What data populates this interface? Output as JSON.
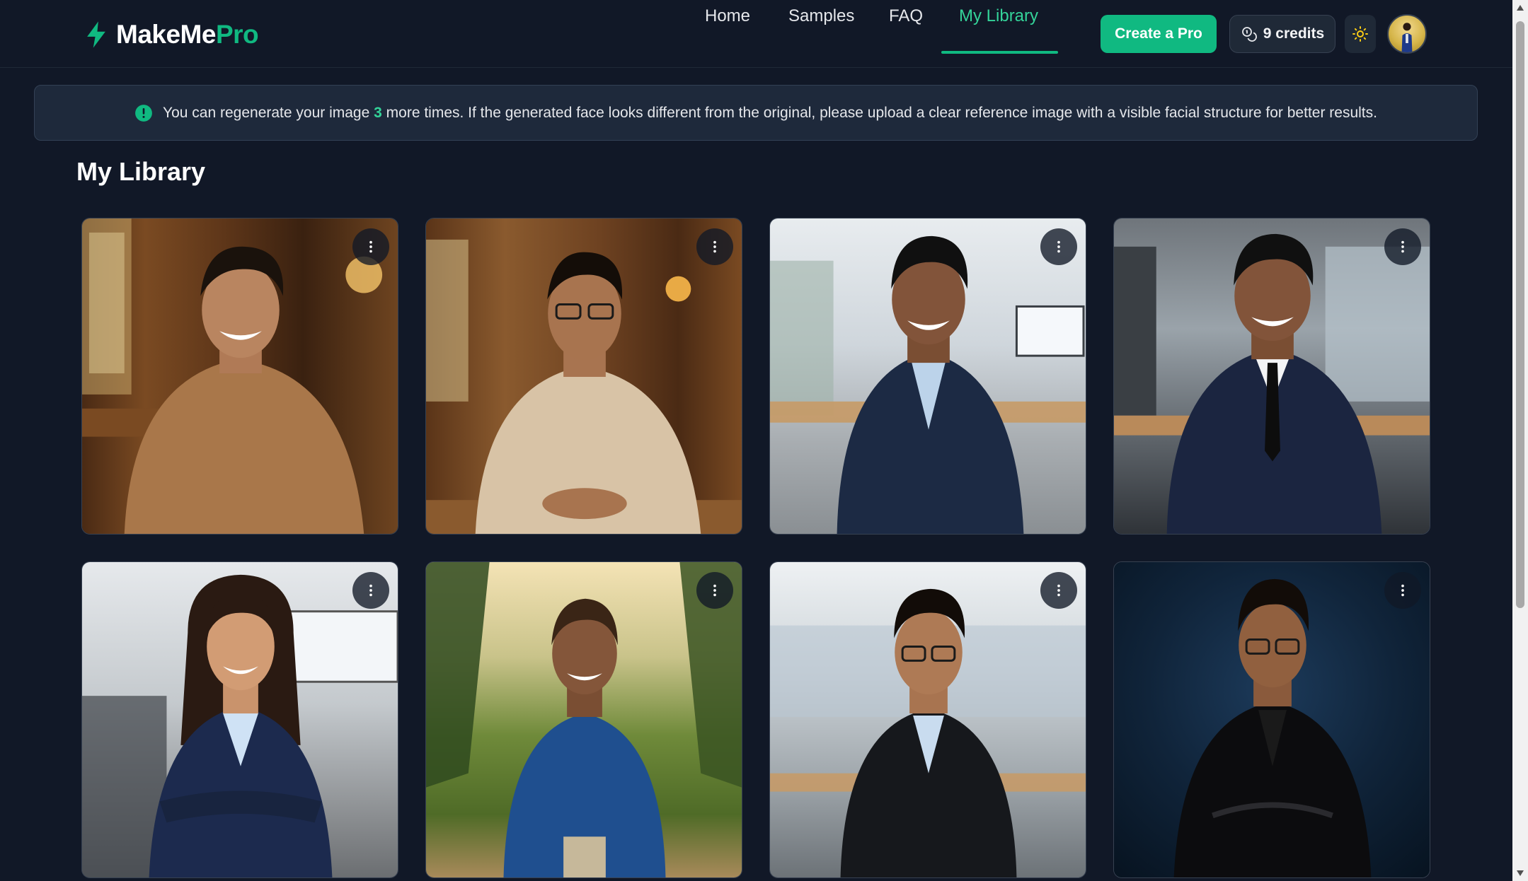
{
  "brand": {
    "name_part1": "MakeMe",
    "name_part2": "Pro"
  },
  "nav": {
    "items": [
      {
        "label": "Home"
      },
      {
        "label": "Samples"
      },
      {
        "label": "FAQ"
      },
      {
        "label": "My Library"
      }
    ],
    "active": "My Library"
  },
  "header": {
    "create_button": "Create a Pro",
    "credits_label": "9 credits",
    "theme_icon": "sun-icon",
    "avatar_icon": "user-avatar"
  },
  "banner": {
    "text_before": "You can regenerate your image",
    "count": "3",
    "text_after": "more times. If the generated face looks different from the original, please upload a clear reference image with a visible facial structure for better results."
  },
  "page": {
    "title": "My Library"
  },
  "colors": {
    "accent": "#10b981",
    "background": "#111827",
    "banner_bg": "#1e293b"
  },
  "library": {
    "images": [
      {
        "scene": "wooden cabin, brown sweater"
      },
      {
        "scene": "wooden cabin, beige sweater, glasses"
      },
      {
        "scene": "office, navy suit, open collar"
      },
      {
        "scene": "office, navy suit, tie"
      },
      {
        "scene": "office, navy blazer, woman"
      },
      {
        "scene": "forest trail, blue jacket"
      },
      {
        "scene": "office, black blazer, glasses"
      },
      {
        "scene": "dark studio, leather jacket"
      }
    ]
  }
}
